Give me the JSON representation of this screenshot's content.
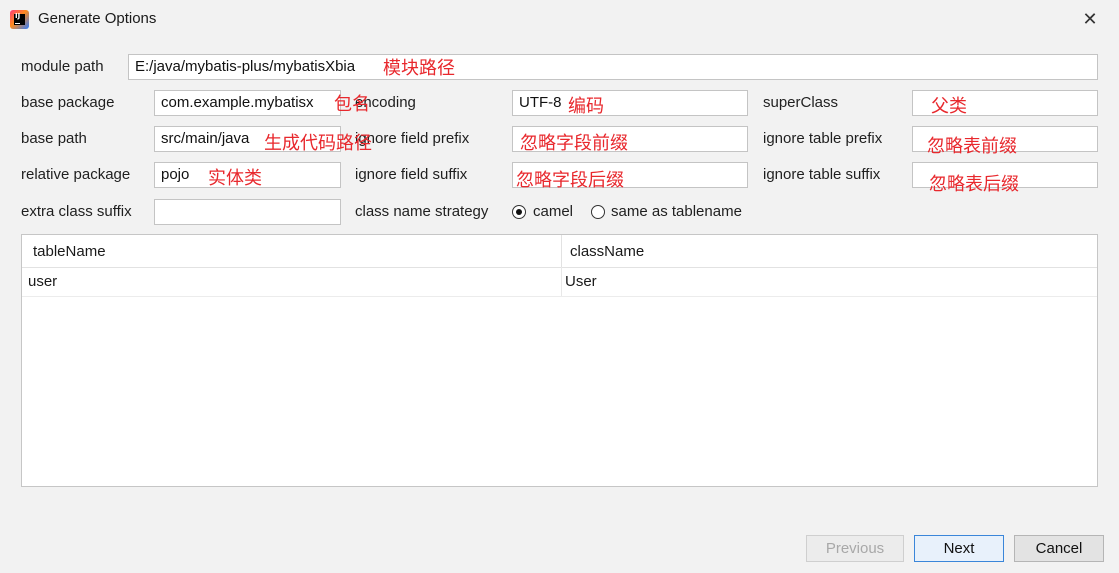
{
  "window": {
    "title": "Generate Options",
    "close_icon": "close-icon",
    "app_icon": "intellij-idea-icon"
  },
  "form": {
    "module_path": {
      "label": "module path",
      "value": "E:/java/mybatis-plus/mybatisXbia",
      "note": "模块路径"
    },
    "base_package": {
      "label": "base package",
      "value": "com.example.mybatisx",
      "note": "包名"
    },
    "base_path": {
      "label": "base path",
      "value": "src/main/java",
      "note": "生成代码路径"
    },
    "relative_package": {
      "label": "relative package",
      "value": "pojo",
      "note": "实体类"
    },
    "extra_class_suffix": {
      "label": "extra class suffix",
      "value": ""
    },
    "encoding": {
      "label": "encoding",
      "value": "UTF-8",
      "note": "编码"
    },
    "ignore_field_prefix": {
      "label": "ignore field prefix",
      "value": "",
      "note": "忽略字段前缀"
    },
    "ignore_field_suffix": {
      "label": "ignore field suffix",
      "value": "",
      "note": "忽略字段后缀"
    },
    "class_name_strategy": {
      "label": "class name strategy",
      "options": [
        {
          "label": "camel",
          "selected": true
        },
        {
          "label": "same as tablename",
          "selected": false
        }
      ]
    },
    "super_class": {
      "label": "superClass",
      "value": "",
      "note": "父类"
    },
    "ignore_table_prefix": {
      "label": "ignore table prefix",
      "value": "",
      "note": "忽略表前缀"
    },
    "ignore_table_suffix": {
      "label": "ignore table suffix",
      "value": "",
      "note": "忽略表后缀"
    }
  },
  "table": {
    "columns": [
      "tableName",
      "className"
    ],
    "rows": [
      [
        "user",
        "User"
      ]
    ]
  },
  "buttons": {
    "previous": "Previous",
    "next": "Next",
    "cancel": "Cancel"
  },
  "colors": {
    "annotation": "#e8282d",
    "primary_border": "#3b86d9"
  }
}
